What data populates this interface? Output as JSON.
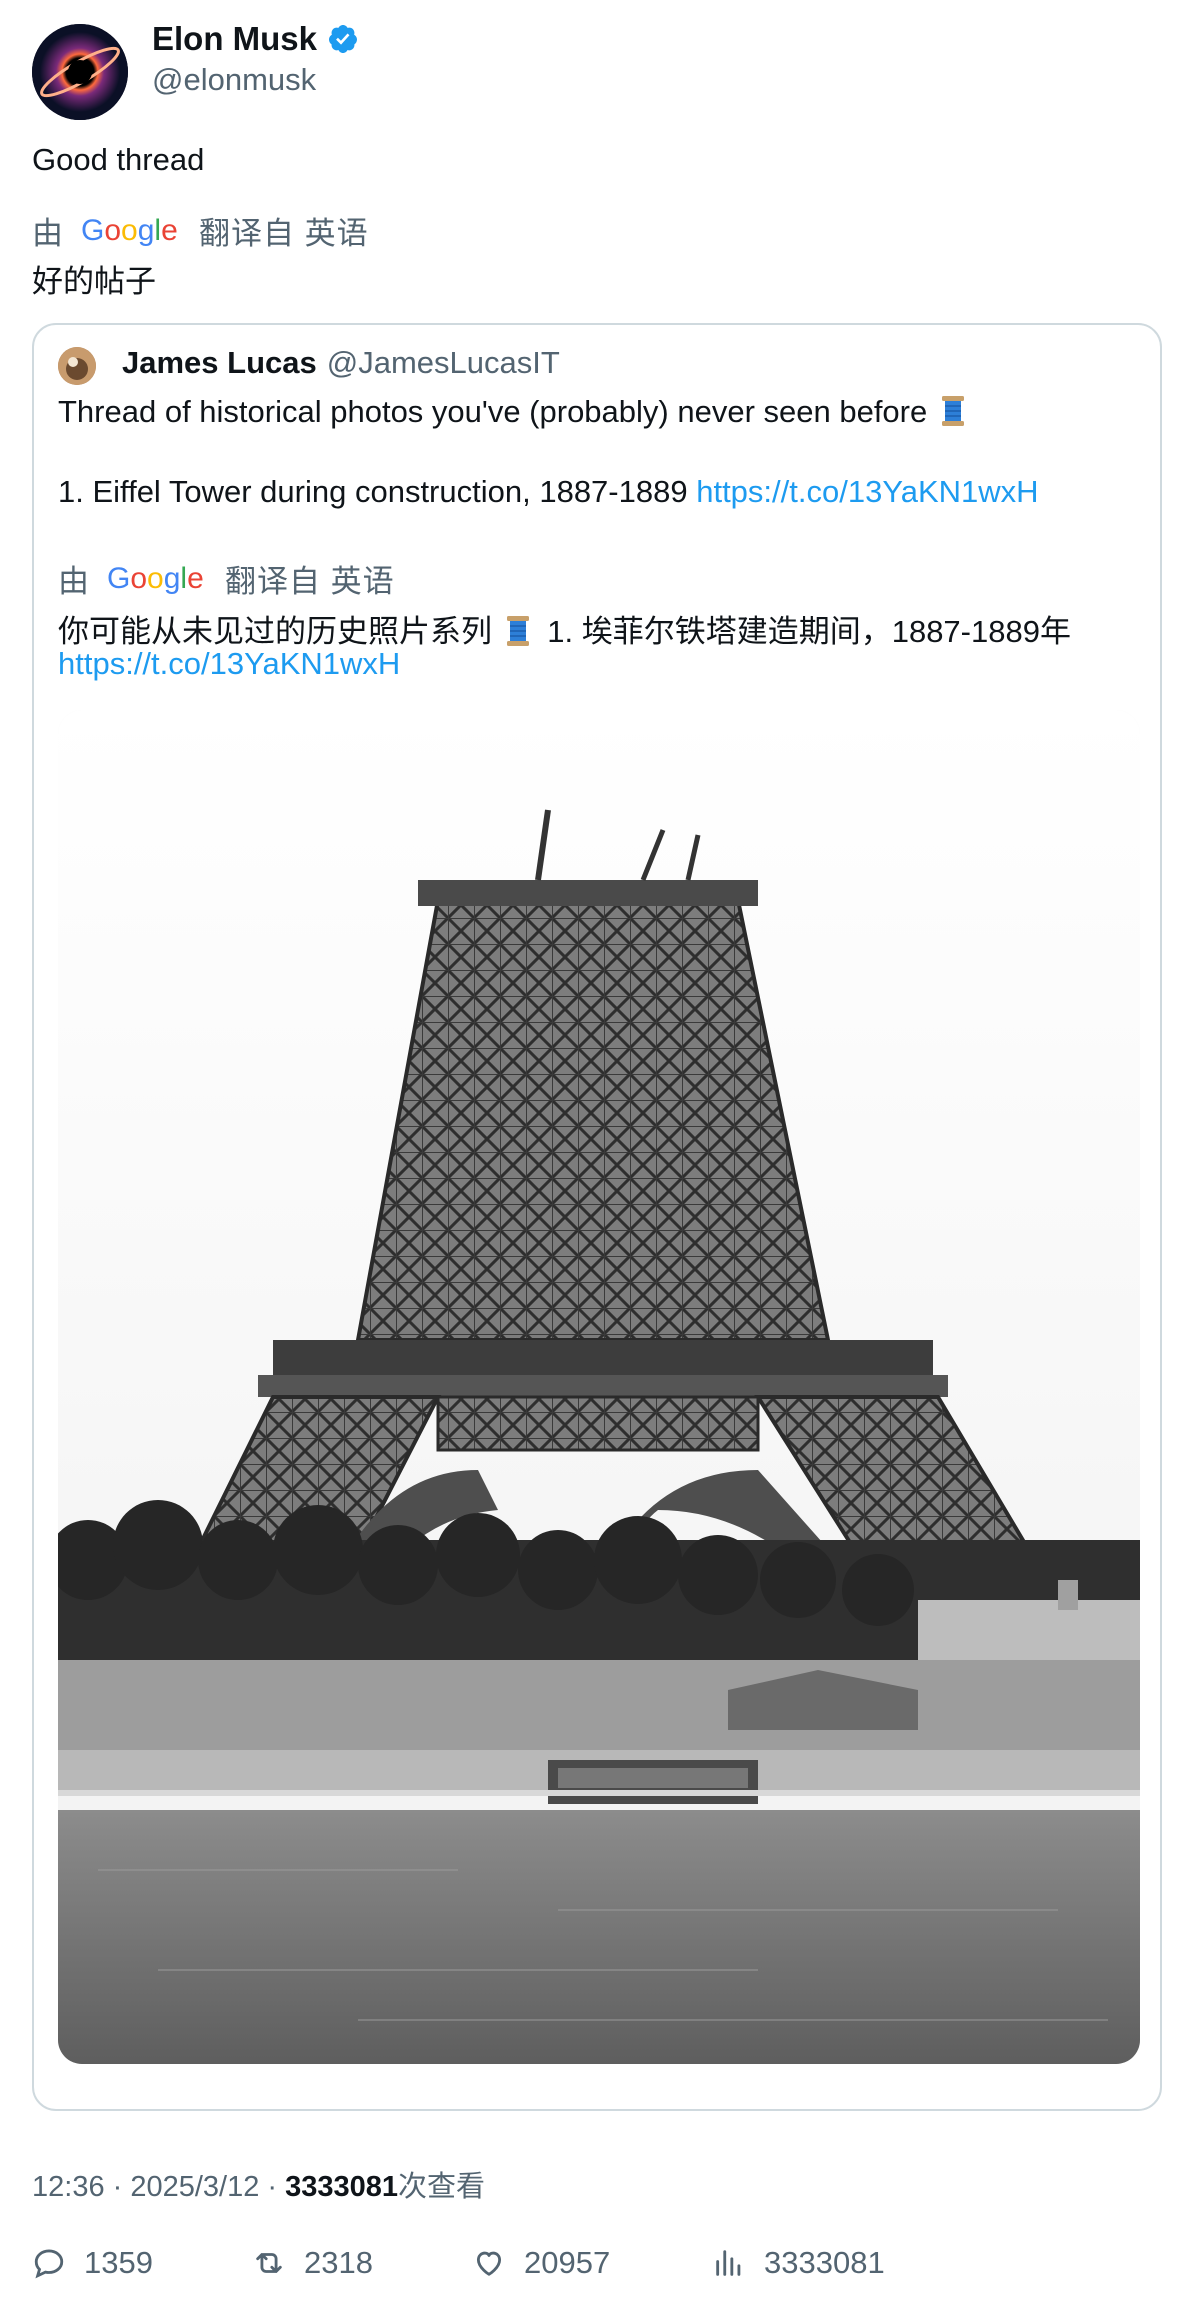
{
  "author": {
    "name": "Elon Musk",
    "handle": "@elonmusk"
  },
  "tweet": {
    "text": "Good thread",
    "translation_prefix": "由",
    "translation_suffix": "翻译自 英语",
    "translated_text": "好的帖子"
  },
  "quoted": {
    "name": "James Lucas",
    "handle": "@JamesLucasIT",
    "line1": "Thread of historical photos you've (probably) never seen before",
    "line2": "1. Eiffel Tower during construction, 1887-1889",
    "link": "https://t.co/13YaKN1wxH",
    "translation_prefix": "由",
    "translation_suffix": "翻译自 英语",
    "translated_line1": "你可能从未见过的历史照片系列",
    "translated_line1b": "1. 埃菲尔铁塔建造期间，1887-1889年",
    "translated_link": "https://t.co/13YaKN1wxH"
  },
  "meta": {
    "time": "12:36 · 2025/3/12 · ",
    "views": "3333081",
    "views_suffix": "次查看"
  },
  "actions": {
    "replies": "1359",
    "reposts": "2318",
    "likes": "20957",
    "views": "3333081"
  },
  "icons": [
    "verified-badge-icon",
    "google-logo",
    "spool-of-thread-icon",
    "reply-icon",
    "repost-icon",
    "like-icon",
    "views-icon"
  ],
  "colors": {
    "link": "#1d9bf0",
    "secondary_text": "#536471",
    "border": "#cfd9de"
  }
}
